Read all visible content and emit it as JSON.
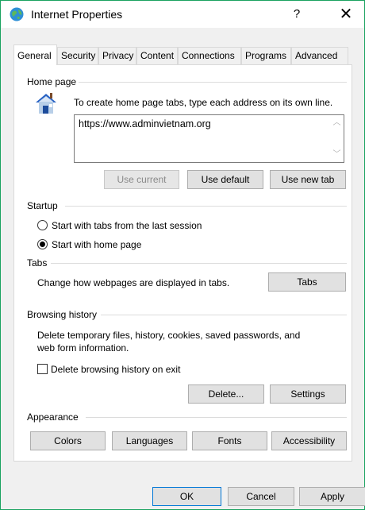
{
  "window": {
    "title": "Internet Properties",
    "help_label": "?",
    "close_label": "✕"
  },
  "tabs": [
    {
      "label": "General",
      "active": true
    },
    {
      "label": "Security"
    },
    {
      "label": "Privacy"
    },
    {
      "label": "Content"
    },
    {
      "label": "Connections"
    },
    {
      "label": "Programs"
    },
    {
      "label": "Advanced"
    }
  ],
  "home_page": {
    "heading": "Home page",
    "description": "To create home page tabs, type each address on its own line.",
    "url": "https://www.adminvietnam.org",
    "use_current": "Use current",
    "use_default": "Use default",
    "use_new_tab": "Use new tab"
  },
  "startup": {
    "heading": "Startup",
    "option_last_session": "Start with tabs from the last session",
    "option_home_page": "Start with home page",
    "selected": "home_page"
  },
  "tabs_group": {
    "heading": "Tabs",
    "description": "Change how webpages are displayed in tabs.",
    "button": "Tabs"
  },
  "browsing_history": {
    "heading": "Browsing history",
    "description_line1": "Delete temporary files, history, cookies, saved passwords, and",
    "description_line2": "web form information.",
    "checkbox_label": "Delete browsing history on exit",
    "checkbox_checked": false,
    "delete_button": "Delete...",
    "settings_button": "Settings"
  },
  "appearance": {
    "heading": "Appearance",
    "colors": "Colors",
    "languages": "Languages",
    "fonts": "Fonts",
    "accessibility": "Accessibility"
  },
  "footer": {
    "ok": "OK",
    "cancel": "Cancel",
    "apply": "Apply"
  },
  "colors": {
    "window_border": "#1aa260",
    "primary_border": "#0078d7"
  }
}
